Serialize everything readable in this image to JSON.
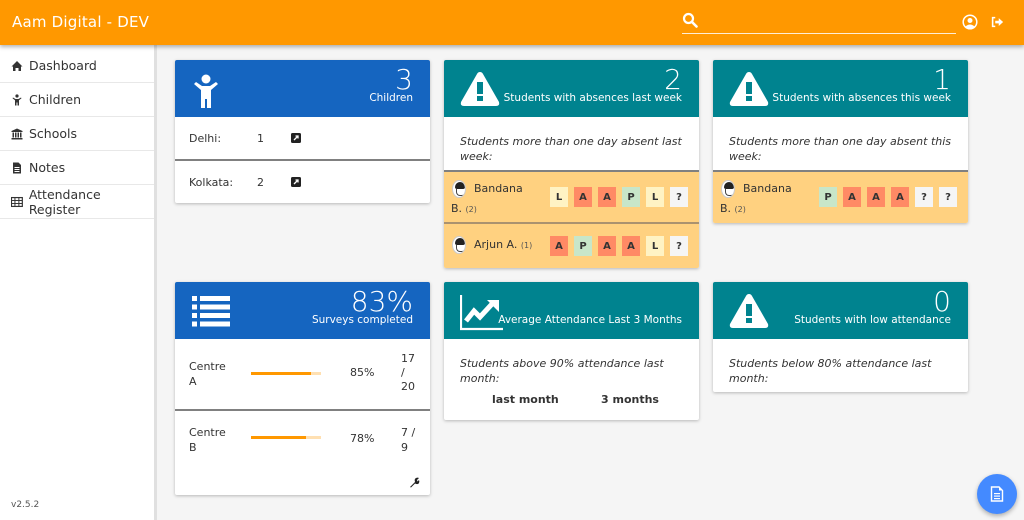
{
  "app": {
    "title": "Aam Digital - DEV"
  },
  "search": {
    "placeholder": "",
    "value": ""
  },
  "toolbar": {
    "icons": [
      "search-icon",
      "user-profile-icon",
      "logout-icon"
    ]
  },
  "sidebar": {
    "items": [
      {
        "label": "Dashboard",
        "icon": "home-icon"
      },
      {
        "label": "Children",
        "icon": "child-icon"
      },
      {
        "label": "Schools",
        "icon": "university-icon"
      },
      {
        "label": "Notes",
        "icon": "file-text-icon"
      },
      {
        "label": "Attendance Register",
        "icon": "table-icon"
      }
    ],
    "version": "v2.5.2"
  },
  "cards": {
    "children": {
      "count": "3",
      "label": "Children",
      "rows": [
        {
          "name": "Delhi:",
          "count": "1"
        },
        {
          "name": "Kolkata:",
          "count": "2"
        }
      ]
    },
    "absences_last_week": {
      "count": "2",
      "label": "Students with absences last week",
      "description": "Students more than one day absent last week:",
      "students": [
        {
          "name_first": "Bandana",
          "name_last": "B.",
          "count": "(2)",
          "attendance": [
            "L",
            "A",
            "A",
            "P",
            "L",
            "?"
          ]
        },
        {
          "name_first": "Arjun A.",
          "name_last": "",
          "count": "(1)",
          "attendance": [
            "A",
            "P",
            "A",
            "A",
            "L",
            "?"
          ]
        }
      ]
    },
    "absences_this_week": {
      "count": "1",
      "label": "Students with absences this week",
      "description": "Students more than one day absent this week:",
      "students": [
        {
          "name_first": "Bandana",
          "name_last": "B.",
          "count": "(2)",
          "attendance": [
            "P",
            "A",
            "A",
            "A",
            "?",
            "?"
          ]
        }
      ]
    },
    "surveys": {
      "count": "83%",
      "label": "Surveys completed",
      "rows": [
        {
          "name_line1": "Centre",
          "name_line2": "A",
          "percent": "85%",
          "progress": 0.85,
          "fraction_line1": "17",
          "fraction_line2": "/",
          "fraction_line3": "20"
        },
        {
          "name_line1": "Centre",
          "name_line2": "B",
          "percent": "78%",
          "progress": 0.78,
          "fraction_line1": "7 /",
          "fraction_line2": "9",
          "fraction_line3": ""
        }
      ]
    },
    "avg_attendance": {
      "label": "Average Attendance Last 3 Months",
      "description": "Students above 90% attendance last month:",
      "col1": "last month",
      "col2": "3 months"
    },
    "low_attendance": {
      "count": "0",
      "label": "Students with low attendance",
      "description": "Students below 80% attendance last month:"
    }
  },
  "colors": {
    "primary": "#ff9800",
    "blue": "#1565c0",
    "teal": "#00838f",
    "absent": "#ff8a65",
    "present": "#c8e6c9",
    "late": "#fff3c4",
    "highlight_row": "#ffd180",
    "fab": "#448aff"
  }
}
